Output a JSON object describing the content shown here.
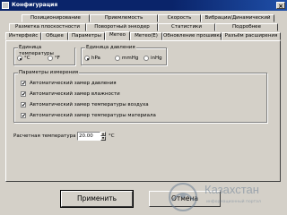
{
  "window": {
    "title": "Конфигурация",
    "close_glyph": "×"
  },
  "tabs": {
    "row1": [
      "Позиционирование",
      "Приемлемость",
      "Скорость",
      "Вибрации/Динамический"
    ],
    "row2": [
      "Разметка плоскостности",
      "Поворотный энкодер",
      "Статистики",
      "Подробнее"
    ],
    "row3": [
      "Интерфейс",
      "Общее",
      "Параметры",
      "Метео",
      "Метео(E)",
      "Обновление прошивки",
      "Разъём расширения"
    ],
    "active": "Метео"
  },
  "temp_unit": {
    "legend": "Единица температуры",
    "options": [
      "°C",
      "°F"
    ],
    "selected": "°C"
  },
  "pressure_unit": {
    "legend": "Единица давления",
    "options": [
      "hPa",
      "mmHg",
      "inHg"
    ],
    "selected": "hPa"
  },
  "measure": {
    "legend": "Параметры измерения",
    "items": [
      {
        "label": "Автоматический замер давления",
        "checked": true
      },
      {
        "label": "Автоматический замер влажности",
        "checked": true
      },
      {
        "label": "Автоматический замер температуры воздуха",
        "checked": true
      },
      {
        "label": "Автоматический замер температуры материала",
        "checked": true
      }
    ]
  },
  "calc_temp": {
    "label": "Расчетная температура",
    "value": "20.00",
    "unit": "°C"
  },
  "buttons": {
    "apply": "Применить",
    "cancel": "Отмена"
  },
  "watermark": {
    "text": "Казахстан",
    "subtext": "информационный портал"
  },
  "icons": {
    "app": "app-icon",
    "close": "close-icon",
    "check": "✔"
  }
}
